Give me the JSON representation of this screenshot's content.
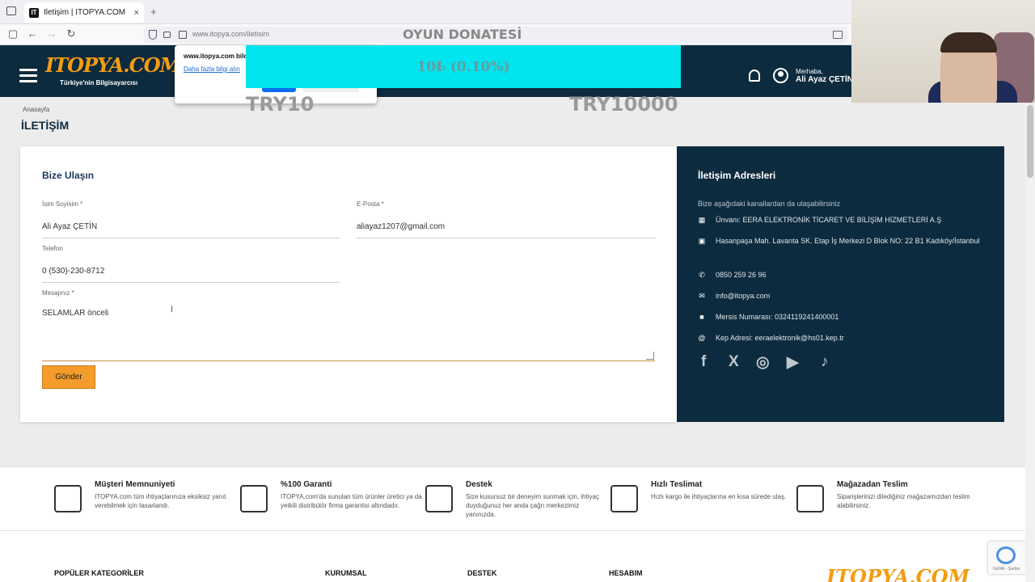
{
  "browser": {
    "tab_title": "İletişim | ITOPYA.COM",
    "favicon": "IT",
    "url": "www.itopya.com/iletisim",
    "new_tab": "+",
    "tab_close": "×"
  },
  "header": {
    "logo": "ITOPYA.COM",
    "tagline": "Türkiye'nin Bilgisayarcısı",
    "greeting": "Merhaba,",
    "user_name": "Ali Ayaz ÇETİN"
  },
  "popup": {
    "title": "www.itopya.com bild",
    "link": "Daha fazla bilgi alın"
  },
  "donation": {
    "title": "OYUN DONATESİ",
    "value": "10₺ (0.10%)",
    "min": "TRY10",
    "max": "TRY10000",
    "bar_color": "#00e5ee",
    "progress_percent": 0.1
  },
  "breadcrumb": "Anasayfa",
  "page_title": "İLETİŞİM",
  "form": {
    "title": "Bize Ulaşın",
    "name_label": "İsim Soyisim *",
    "name_value": "Ali Ayaz ÇETİN",
    "email_label": "E-Posta *",
    "email_value": "aliayaz1207@gmail.com",
    "phone_label": "Telefon",
    "phone_value": "0 (530)-230-8712",
    "message_label": "Mesajınız *",
    "message_value": "SELAMLAR önceli",
    "submit": "Gönder",
    "accent": "#f39c2b"
  },
  "contact": {
    "title": "İletişim Adresleri",
    "subtitle": "Bize aşağıdaki kanallardan da ulaşabilirsiniz",
    "rows": [
      {
        "icon": "building-icon",
        "glyph": "▦",
        "text": "Ünvanı: EERA ELEKTRONİK TİCARET VE BİLİŞİM HİZMETLERİ A.Ş"
      },
      {
        "icon": "map-icon",
        "glyph": "▣",
        "text": "Hasanpaşa Mah. Lavanta SK. Etap İş Merkezi D Blok NO: 22 B1 Kadıköy/İstanbul"
      },
      {
        "icon": "phone-icon",
        "glyph": "✆",
        "text": "0850 259 26 96"
      },
      {
        "icon": "envelope-icon",
        "glyph": "✉",
        "text": "info@itopya.com"
      },
      {
        "icon": "briefcase-icon",
        "glyph": "■",
        "text": "Mersis Numarası: 0324119241400001"
      },
      {
        "icon": "at-icon",
        "glyph": "@",
        "text": "Kep Adresi: eeraelektronik@hs01.kep.tr"
      }
    ],
    "bg": "#0d2b3e"
  },
  "features": [
    {
      "icon": "thumbs-up-icon",
      "title": "Müşteri Memnuniyeti",
      "desc": "ITOPYA.com tüm ihtiyaçlarınıza eksiksiz yanıt verebilmek için tasarlandı."
    },
    {
      "icon": "certificate-icon",
      "title": "%100 Garanti",
      "desc": "ITOPYA.com'da sunulan tüm ürünler üretici ya da yetkili distribütör firma garantisi altındadır."
    },
    {
      "icon": "support-icon",
      "title": "Destek",
      "desc": "Size kusursuz bir deneyim sunmak için, ihtiyaç duyduğunuz her anda çağrı merkezimiz yanınızda."
    },
    {
      "icon": "truck-icon",
      "title": "Hızlı Teslimat",
      "desc": "Hızlı kargo ile ihtiyaçlarına en kısa sürede ulaş."
    },
    {
      "icon": "store-icon",
      "title": "Mağazadan Teslim",
      "desc": "Siparişlerinizi dilediğiniz mağazamızdan teslim alabilirsiniz."
    }
  ],
  "footer": {
    "headings": [
      "POPÜLER KATEGORİLER",
      "KURUMSAL",
      "DESTEK",
      "HESABIM"
    ],
    "logo": "ITOPYA.COM",
    "recaptcha": "Gizlilik - Şartlar"
  }
}
